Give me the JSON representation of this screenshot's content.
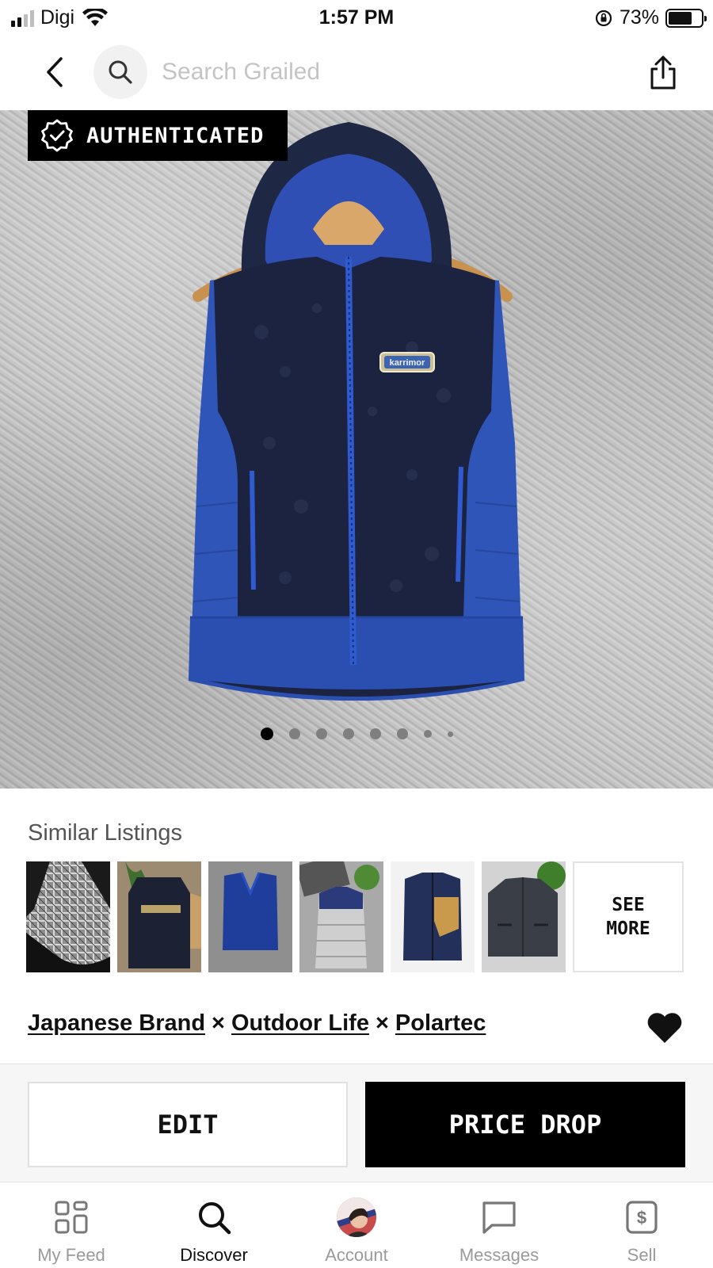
{
  "status_bar": {
    "carrier": "Digi",
    "time": "1:57 PM",
    "battery_percent": "73%",
    "battery_level": 0.73
  },
  "nav": {
    "search_placeholder": "Search Grailed",
    "icons": [
      "chevron-left-icon",
      "search-icon",
      "share-icon"
    ]
  },
  "hero": {
    "badge_label": "AUTHENTICATED",
    "patch_text": "karrimor",
    "image_count": 8,
    "active_index": 0
  },
  "similar": {
    "title": "Similar Listings",
    "see_more_line1": "SEE",
    "see_more_line2": "MORE"
  },
  "brands": {
    "items": [
      "Japanese Brand",
      "Outdoor Life",
      "Polartec"
    ],
    "separator": "×"
  },
  "actions": {
    "edit_label": "EDIT",
    "price_drop_label": "PRICE DROP"
  },
  "tabs": [
    {
      "label": "My Feed",
      "icon": "grid-icon",
      "active": false
    },
    {
      "label": "Discover",
      "icon": "search-icon",
      "active": true
    },
    {
      "label": "Account",
      "icon": "avatar",
      "active": false
    },
    {
      "label": "Messages",
      "icon": "message-icon",
      "active": false
    },
    {
      "label": "Sell",
      "icon": "dollar-tag-icon",
      "active": false
    }
  ],
  "colors": {
    "accent": "#000000",
    "vest_fleece": "#1b2340",
    "vest_nylon": "#2f55b8",
    "background_text_muted": "#9a9a9a"
  }
}
